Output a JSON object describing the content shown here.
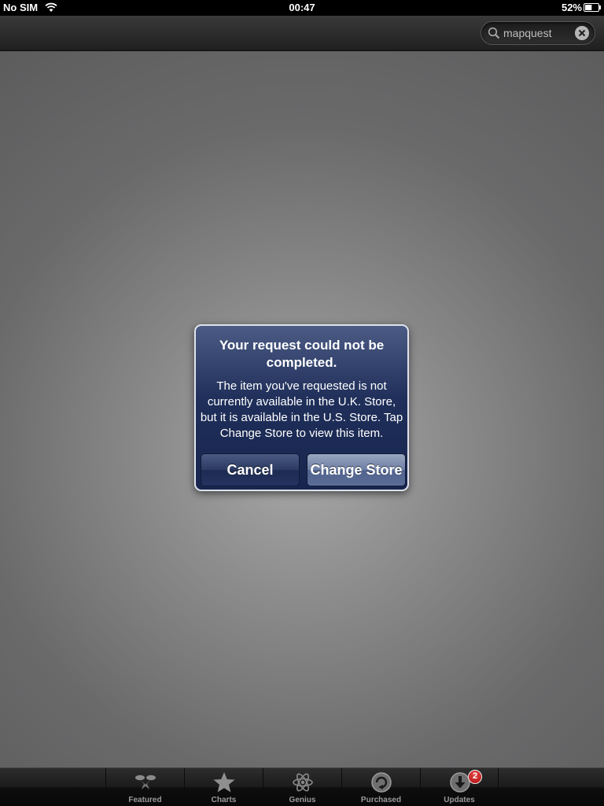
{
  "status_bar": {
    "carrier": "No SIM",
    "time": "00:47",
    "battery_percent": "52%",
    "battery_level": 0.52
  },
  "search": {
    "value": "mapquest"
  },
  "alert": {
    "title": "Your request could not be completed.",
    "message": "The item you've requested is not currently available in the U.K. Store, but it is available in the U.S. Store. Tap Change Store to view this item.",
    "cancel_label": "Cancel",
    "confirm_label": "Change Store"
  },
  "tab_bar": {
    "items": [
      {
        "label": "Featured",
        "icon": "featured-icon"
      },
      {
        "label": "Charts",
        "icon": "star-icon"
      },
      {
        "label": "Genius",
        "icon": "atom-icon"
      },
      {
        "label": "Purchased",
        "icon": "purchased-icon"
      },
      {
        "label": "Updates",
        "icon": "download-icon",
        "badge": "2"
      }
    ]
  },
  "colors": {
    "alert_background": "#1f2f5a",
    "badge": "#c41a1a"
  }
}
